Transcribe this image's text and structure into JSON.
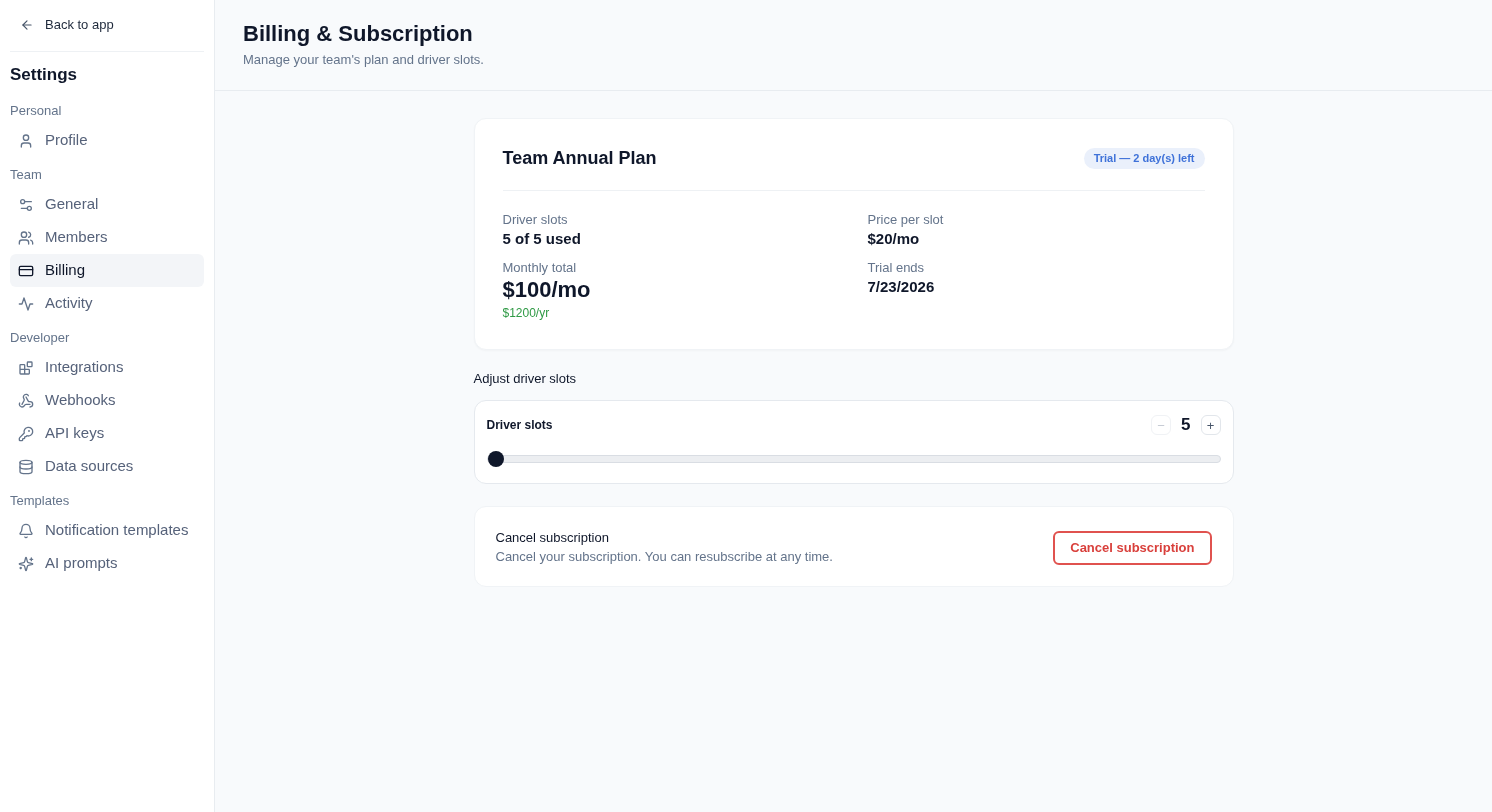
{
  "back_link": {
    "label": "Back to app"
  },
  "sidebar": {
    "title": "Settings",
    "sections": [
      {
        "label": "Personal",
        "items": [
          {
            "label": "Profile",
            "selected": false
          }
        ]
      },
      {
        "label": "Team",
        "items": [
          {
            "label": "General",
            "selected": false
          },
          {
            "label": "Members",
            "selected": false
          },
          {
            "label": "Billing",
            "selected": true
          },
          {
            "label": "Activity",
            "selected": false
          }
        ]
      },
      {
        "label": "Developer",
        "items": [
          {
            "label": "Integrations",
            "selected": false
          },
          {
            "label": "Webhooks",
            "selected": false
          },
          {
            "label": "API keys",
            "selected": false
          },
          {
            "label": "Data sources",
            "selected": false
          }
        ]
      },
      {
        "label": "Templates",
        "items": [
          {
            "label": "Notification templates",
            "selected": false
          },
          {
            "label": "AI prompts",
            "selected": false
          }
        ]
      }
    ]
  },
  "header": {
    "title": "Billing & Subscription",
    "subtitle": "Manage your team's plan and driver slots."
  },
  "plan": {
    "name": "Team Annual Plan",
    "badge": "Trial — 2 day(s) left",
    "stats": [
      {
        "kind": "stat",
        "label": "Driver slots",
        "value": "5 of 5 used"
      },
      {
        "kind": "stat",
        "label": "Price per slot",
        "value": "$20/mo"
      },
      {
        "kind": "total",
        "label": "Monthly total",
        "value": "$100/mo",
        "note": "$1200/yr"
      },
      {
        "kind": "stat",
        "label": "Trial ends",
        "value": "7/23/2026"
      }
    ]
  },
  "slots": {
    "heading": "Adjust driver slots",
    "label": "Driver slots",
    "value": "5",
    "decrement": {
      "label": "−",
      "disabled": true
    },
    "increment": {
      "label": "+",
      "disabled": false
    },
    "slider": {
      "level": 0
    }
  },
  "cancel": {
    "title": "Cancel subscription",
    "description": "Cancel your subscription. You can resubscribe at any time.",
    "button": "Cancel subscription"
  }
}
